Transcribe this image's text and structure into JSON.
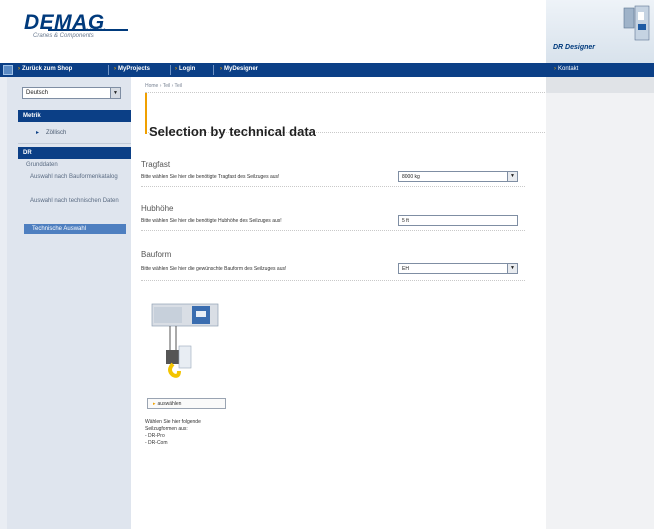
{
  "header": {
    "logo_text": "DEMAG",
    "logo_tagline": "Cranes & Components",
    "right_banner_title": "DR Designer"
  },
  "topnav": {
    "items": [
      {
        "label": "Zurück zum Shop"
      },
      {
        "label": "MyProjects"
      },
      {
        "label": "Login"
      },
      {
        "label": "MyDesigner"
      }
    ],
    "right_item": "Kontakt"
  },
  "sidebar": {
    "language_value": "Deutsch",
    "section_metric": "Metrik",
    "metric_item": "Zöllisch",
    "section_dr": "DR",
    "dr_items": [
      {
        "label": "Grunddaten"
      },
      {
        "label": "Auswahl nach Bauformenkatalog"
      },
      {
        "label": "Auswahl nach technischen Daten"
      }
    ],
    "active_item": "Technische Auswahl"
  },
  "main": {
    "breadcrumb": "Home › Teil › Teil",
    "section_title": "Selection by technical data",
    "fields": [
      {
        "title": "Tragfast",
        "description": "Bitte wählen Sie hier die benötigte Tragfast des Seilzuges aus!",
        "value": "8000 kg",
        "type": "select"
      },
      {
        "title": "Hubhöhe",
        "description": "Bitte wählen Sie hier die benötigte Hubhöhe des Seilzuges aus!",
        "value": "5 ft",
        "type": "input"
      },
      {
        "title": "Bauform",
        "description": "Bitte wählen Sie hier die gewünschte Bauform des Seilzuges aus!",
        "value": "EH",
        "type": "select"
      }
    ],
    "choose_button": "auswählen",
    "note_lines": [
      "Wählen Sie hier folgende",
      "Seilzugformen aus:",
      "- DR-Pro",
      "- DR-Com"
    ]
  },
  "colors": {
    "navy": "#0b3f86",
    "accent": "#f0a000",
    "sidebar_bg": "#dfe5ee"
  }
}
